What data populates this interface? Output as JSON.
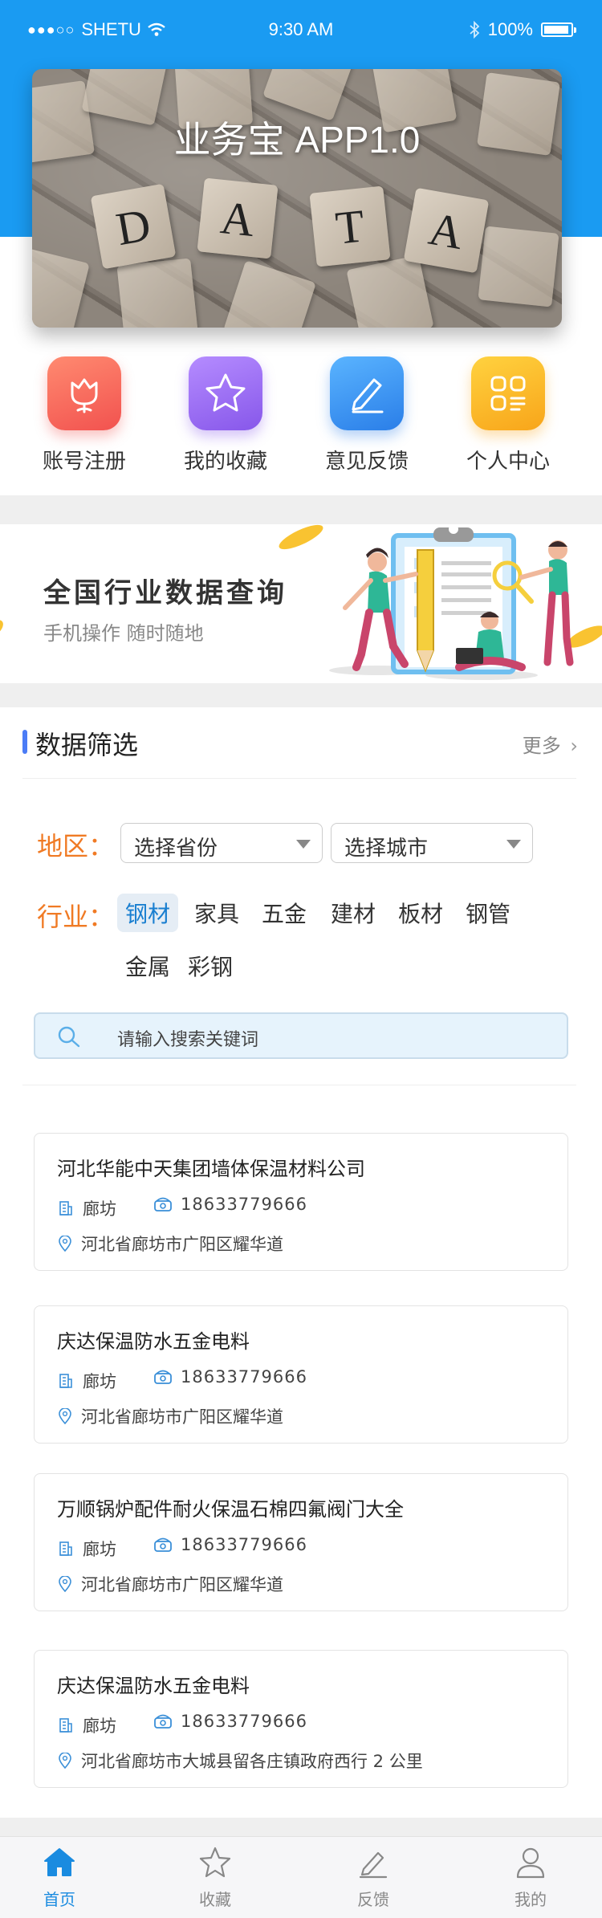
{
  "status_bar": {
    "signal": "●●●○○",
    "carrier": "SHETU",
    "time": "9:30 AM",
    "battery": "100%"
  },
  "banner": {
    "title": "业务宝 APP1.0",
    "tile_letters": [
      "D",
      "A",
      "T",
      "A"
    ]
  },
  "quick_nav": [
    {
      "label": "账号注册",
      "icon": "tulip-icon",
      "color": "#f5655c"
    },
    {
      "label": "我的收藏",
      "icon": "star-icon",
      "color": "#9a6ef2"
    },
    {
      "label": "意见反馈",
      "icon": "pencil-icon",
      "color": "#2f8cf1"
    },
    {
      "label": "个人中心",
      "icon": "apps-icon",
      "color": "#fbb21f"
    }
  ],
  "promo": {
    "title": "全国行业数据查询",
    "subtitle": "手机操作 随时随地"
  },
  "filter": {
    "title": "数据筛选",
    "more": "更多",
    "region_label": "地区：",
    "province_placeholder": "选择省份",
    "city_placeholder": "选择城市",
    "industry_label": "行业：",
    "industries": [
      "钢材",
      "家具",
      "五金",
      "建材",
      "板材",
      "钢管",
      "金属",
      "彩钢"
    ],
    "active_industry": "钢材",
    "search_placeholder": "请输入搜索关键词"
  },
  "companies": [
    {
      "name": "河北华能中天集团墙体保温材料公司",
      "city": "廊坊",
      "phone": "18633779666",
      "address": "河北省廊坊市广阳区耀华道"
    },
    {
      "name": "庆达保温防水五金电料",
      "city": "廊坊",
      "phone": "18633779666",
      "address": "河北省廊坊市广阳区耀华道"
    },
    {
      "name": "万顺锅炉配件耐火保温石棉四氟阀门大全",
      "city": "廊坊",
      "phone": "18633779666",
      "address": "河北省廊坊市广阳区耀华道"
    },
    {
      "name": "庆达保温防水五金电料",
      "city": "廊坊",
      "phone": "18633779666",
      "address": "河北省廊坊市大城县留各庄镇政府西行 2 公里"
    }
  ],
  "tabbar": [
    {
      "label": "首页",
      "icon": "home-icon",
      "active": true
    },
    {
      "label": "收藏",
      "icon": "star-outline-icon",
      "active": false
    },
    {
      "label": "反馈",
      "icon": "edit-icon",
      "active": false
    },
    {
      "label": "我的",
      "icon": "user-icon",
      "active": false
    }
  ],
  "colors": {
    "header_blue": "#1a9bf2",
    "accent_orange": "#f07a24",
    "active_blue": "#1a8be0"
  }
}
